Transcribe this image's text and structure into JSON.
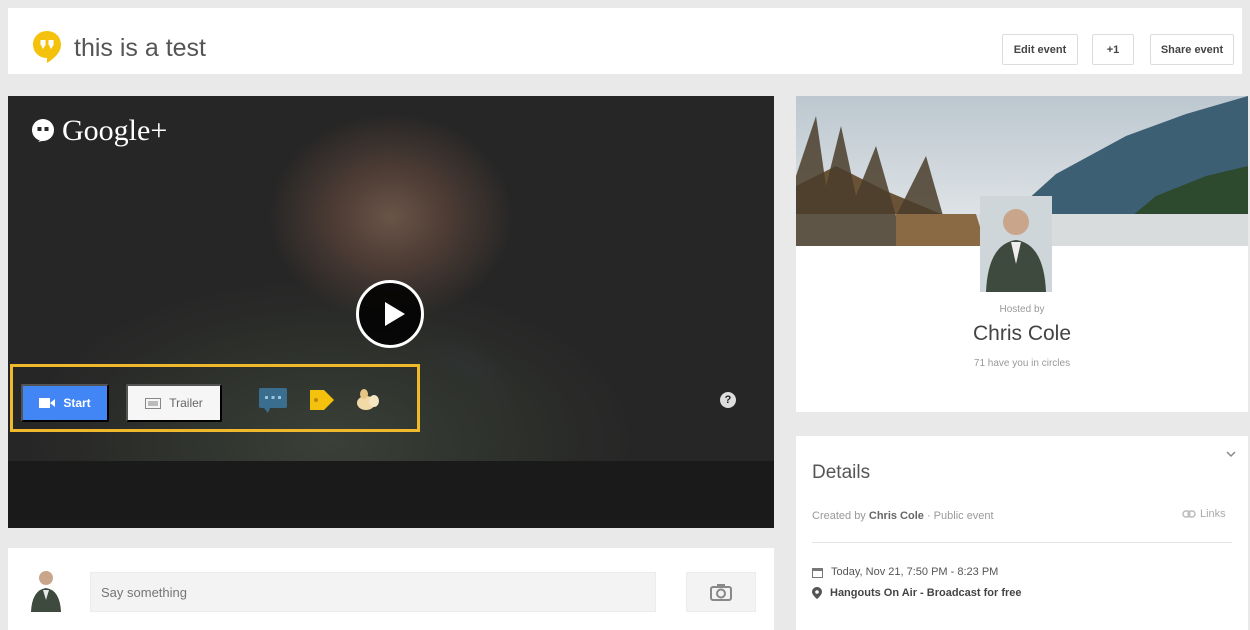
{
  "header": {
    "title": "this is a test",
    "edit_label": "Edit event",
    "plus_label": "+1",
    "share_label": "Share event"
  },
  "video": {
    "brand": "Google+",
    "start_label": "Start",
    "trailer_label": "Trailer",
    "help_symbol": "?"
  },
  "comment": {
    "placeholder": "Say something"
  },
  "host": {
    "hosted_by": "Hosted by",
    "name": "Chris Cole",
    "circles_text": "71 have you in circles"
  },
  "details": {
    "title": "Details",
    "created_prefix": "Created by",
    "creator": "Chris Cole",
    "visibility": "· Public event",
    "links_label": "Links",
    "date_text": "Today, Nov 21, 7:50 PM - 8:23 PM",
    "location_text": "Hangouts On Air - Broadcast for free"
  },
  "colors": {
    "accent_blue": "#4285f4",
    "highlight_yellow": "#f0b82b",
    "hangouts_yellow": "#f4c20d"
  },
  "icons": [
    "hangouts-logo-icon",
    "google-plus-logo-icon",
    "play-icon",
    "video-camera-icon",
    "film-icon",
    "chat-app-icon",
    "tag-app-icon",
    "hands-app-icon",
    "help-icon",
    "camera-icon",
    "link-icon",
    "calendar-icon",
    "location-pin-icon",
    "chevron-down-icon"
  ]
}
